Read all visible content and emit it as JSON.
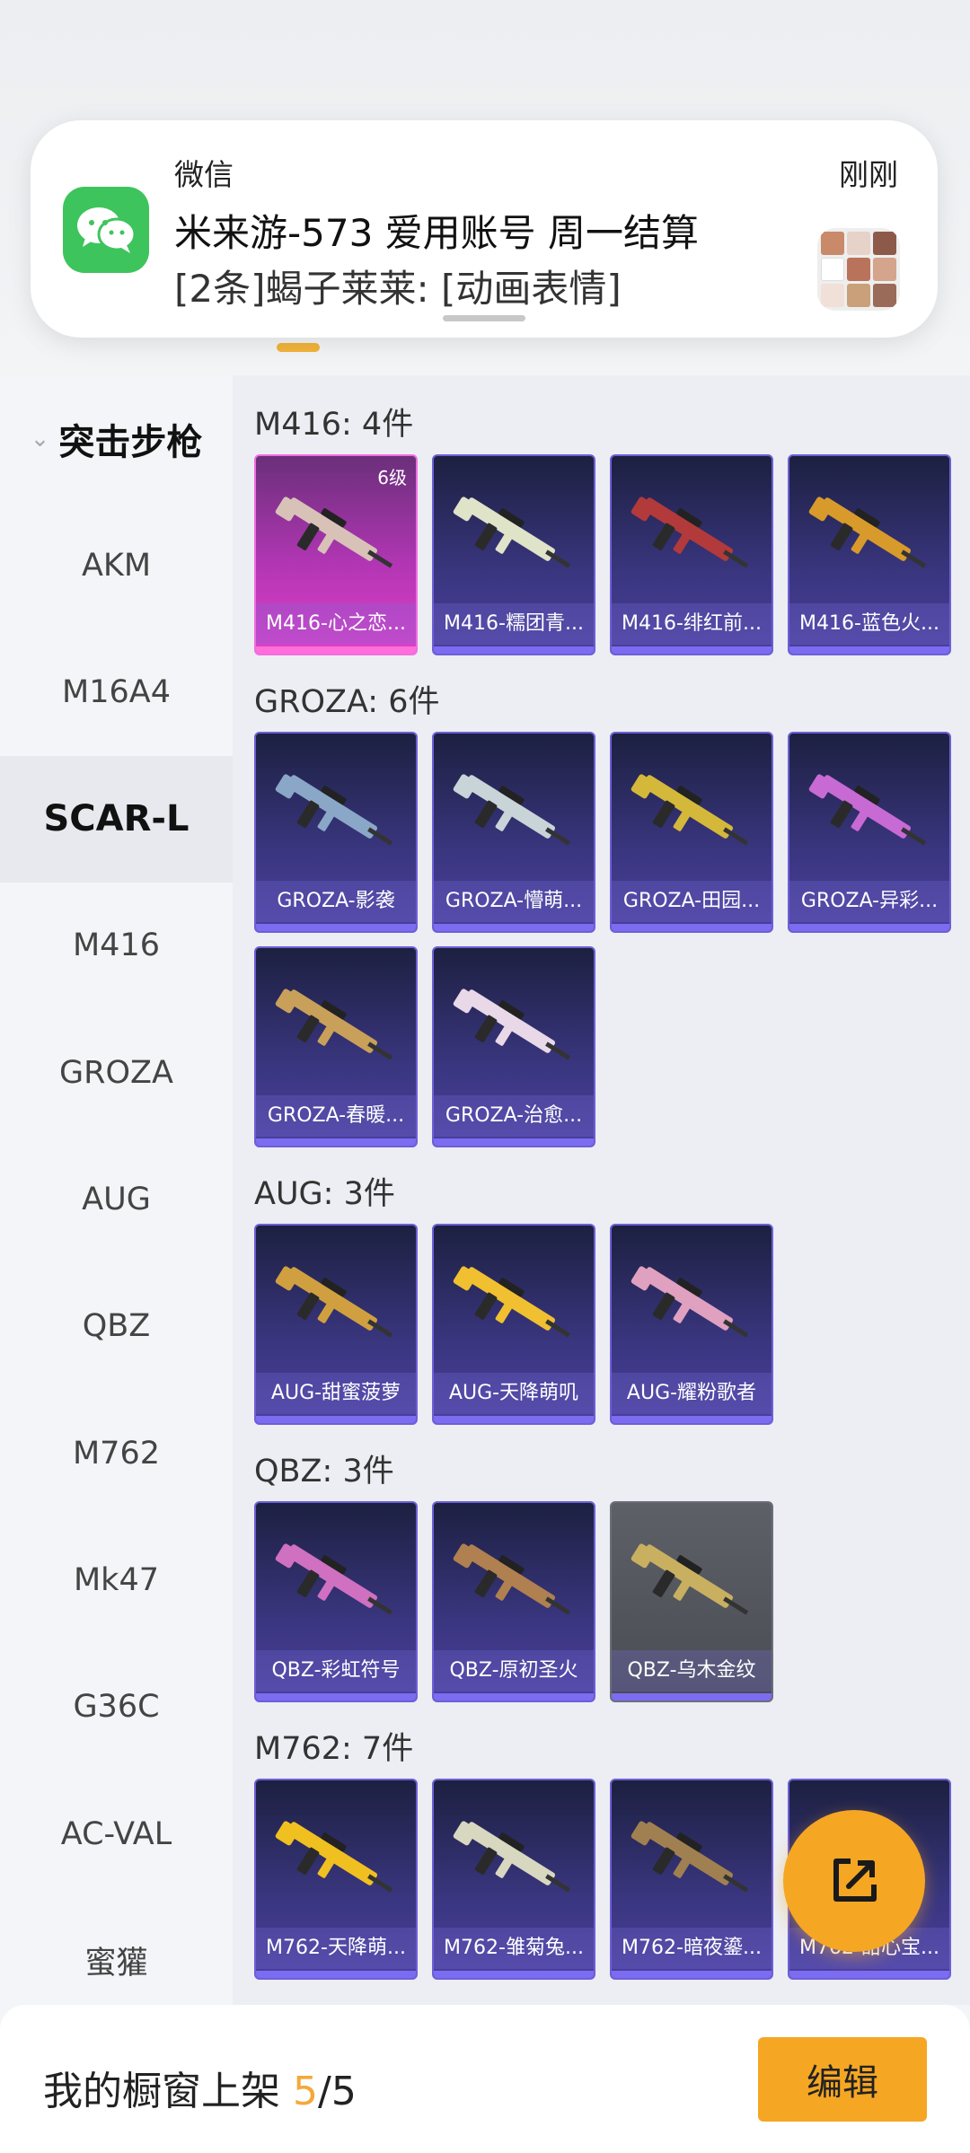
{
  "notification": {
    "app_name": "微信",
    "time": "刚刚",
    "title": "米来游-573 爱用账号  周一结算",
    "body": "[2条]蝎子莱莱: [动画表情]",
    "app_icon": "wechat-icon",
    "accent": "#3ec45c"
  },
  "sidebar": {
    "header": "突击步枪",
    "items": [
      "AKM",
      "M16A4",
      "SCAR-L",
      "M416",
      "GROZA",
      "AUG",
      "QBZ",
      "M762",
      "Mk47",
      "G36C",
      "AC-VAL",
      "蜜獾"
    ],
    "active": "SCAR-L"
  },
  "groups": [
    {
      "title": "M416: 4件",
      "items": [
        {
          "label": "M416-心之恋...",
          "level": "6级",
          "variant": "pink"
        },
        {
          "label": "M416-糯团青...",
          "variant": "purple"
        },
        {
          "label": "M416-绯红前...",
          "variant": "purple"
        },
        {
          "label": "M416-蓝色火...",
          "variant": "purple"
        }
      ]
    },
    {
      "title": "GROZA: 6件",
      "items": [
        {
          "label": "GROZA-影袭",
          "variant": "purple"
        },
        {
          "label": "GROZA-懵萌...",
          "variant": "purple"
        },
        {
          "label": "GROZA-田园...",
          "variant": "purple"
        },
        {
          "label": "GROZA-异彩...",
          "variant": "purple"
        },
        {
          "label": "GROZA-春暖...",
          "variant": "purple"
        },
        {
          "label": "GROZA-治愈...",
          "variant": "purple"
        }
      ]
    },
    {
      "title": "AUG: 3件",
      "items": [
        {
          "label": "AUG-甜蜜菠萝",
          "variant": "purple"
        },
        {
          "label": "AUG-天降萌叽",
          "variant": "purple"
        },
        {
          "label": "AUG-耀粉歌者",
          "variant": "purple"
        }
      ]
    },
    {
      "title": "QBZ: 3件",
      "items": [
        {
          "label": "QBZ-彩虹符号",
          "variant": "purple"
        },
        {
          "label": "QBZ-原初圣火",
          "variant": "purple"
        },
        {
          "label": "QBZ-乌木金纹",
          "variant": "grey"
        }
      ]
    },
    {
      "title": "M762: 7件",
      "items": [
        {
          "label": "M762-天降萌...",
          "variant": "purple"
        },
        {
          "label": "M762-雏菊兔...",
          "variant": "purple"
        },
        {
          "label": "M762-暗夜鎏...",
          "variant": "purple"
        },
        {
          "label": "M762-甜心宝...",
          "variant": "purple"
        }
      ]
    }
  ],
  "fab": {
    "icon": "share-external-icon"
  },
  "bottom": {
    "label": "我的橱窗上架",
    "count": "5",
    "total": "/5",
    "edit_label": "编辑",
    "accent": "#f5a623"
  }
}
